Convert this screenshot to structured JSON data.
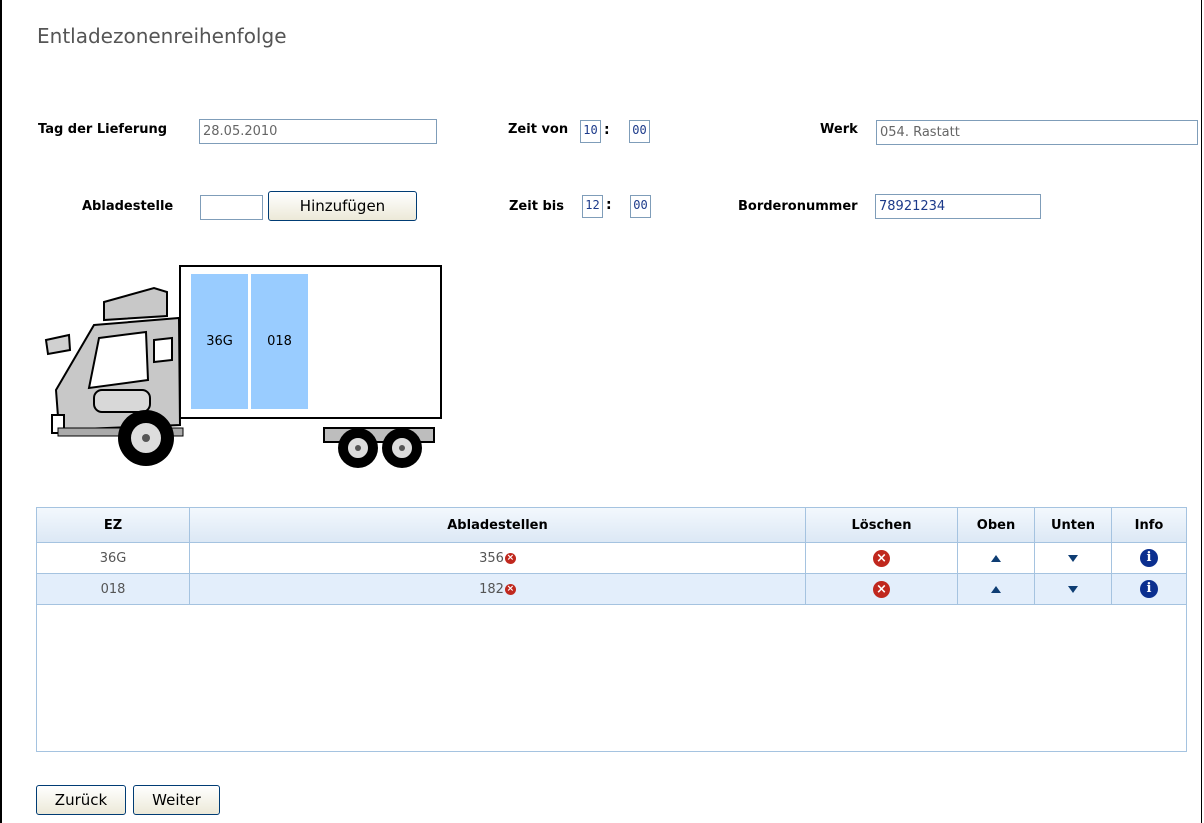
{
  "page": {
    "title": "Entladezonenreihenfolge"
  },
  "form": {
    "tag_label": "Tag der Lieferung",
    "tag_value": "28.05.2010",
    "zeit_von_label": "Zeit von",
    "zeit_von_h": "10",
    "zeit_von_m": "00",
    "werk_label": "Werk",
    "werk_value": "054. Rastatt",
    "abladestelle_label": "Abladestelle",
    "abladestelle_value": "",
    "add_button": "Hinzufügen",
    "zeit_bis_label": "Zeit bis",
    "zeit_bis_h": "12",
    "zeit_bis_m": "00",
    "bordero_label": "Borderonummer",
    "bordero_value": "78921234",
    "colon": ":"
  },
  "truck": {
    "zones": [
      "36G",
      "018"
    ]
  },
  "table": {
    "headers": [
      "EZ",
      "Abladestellen",
      "Löschen",
      "Oben",
      "Unten",
      "Info"
    ],
    "rows": [
      {
        "ez": "36G",
        "abladestellen": "356"
      },
      {
        "ez": "018",
        "abladestellen": "182"
      }
    ]
  },
  "icons": {
    "delete": "delete-icon",
    "up": "arrow-up-icon",
    "down": "arrow-down-icon",
    "info": "info-icon"
  },
  "footer": {
    "back_button": "Zurück",
    "next_button": "Weiter"
  },
  "colors": {
    "zone_fill": "#99ccff",
    "header_bg": "#dce8f5",
    "row_alt": "#e3eefb",
    "delete_red": "#c0281e",
    "info_blue": "#0b2f8f"
  }
}
